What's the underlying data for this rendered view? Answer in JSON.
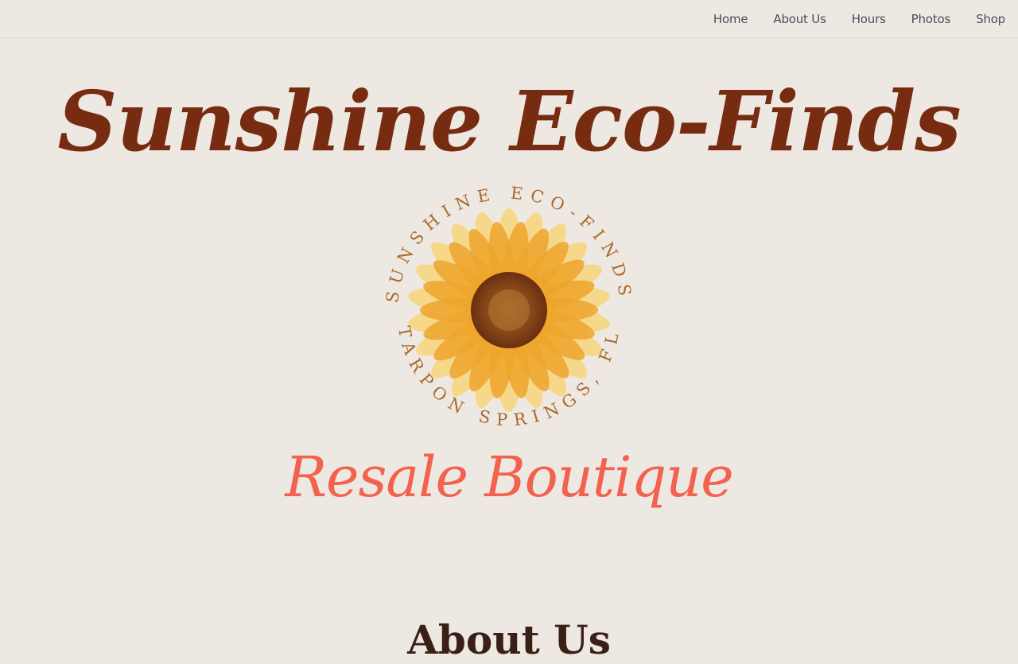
{
  "nav": {
    "items": [
      {
        "label": "Home"
      },
      {
        "label": "About Us"
      },
      {
        "label": "Hours"
      },
      {
        "label": "Photos"
      },
      {
        "label": "Shop"
      }
    ]
  },
  "hero": {
    "title": "Sunshine Eco-Finds",
    "subtitle": "Resale Boutique"
  },
  "logo": {
    "ring_text_top": "SUNSHINE ECO-FINDS",
    "ring_text_bottom": "TARPON SPRINGS, FL",
    "icon": "sunflower-icon"
  },
  "about": {
    "heading": "About Us"
  },
  "colors": {
    "background": "#eee8e2",
    "title": "#772c11",
    "subtitle": "#f2624e",
    "nav_text": "#4a4f59",
    "ring_text": "#a86a2b",
    "petal_light": "#f7d57a",
    "petal_dark": "#eda52c",
    "center": "#7d3f16"
  }
}
